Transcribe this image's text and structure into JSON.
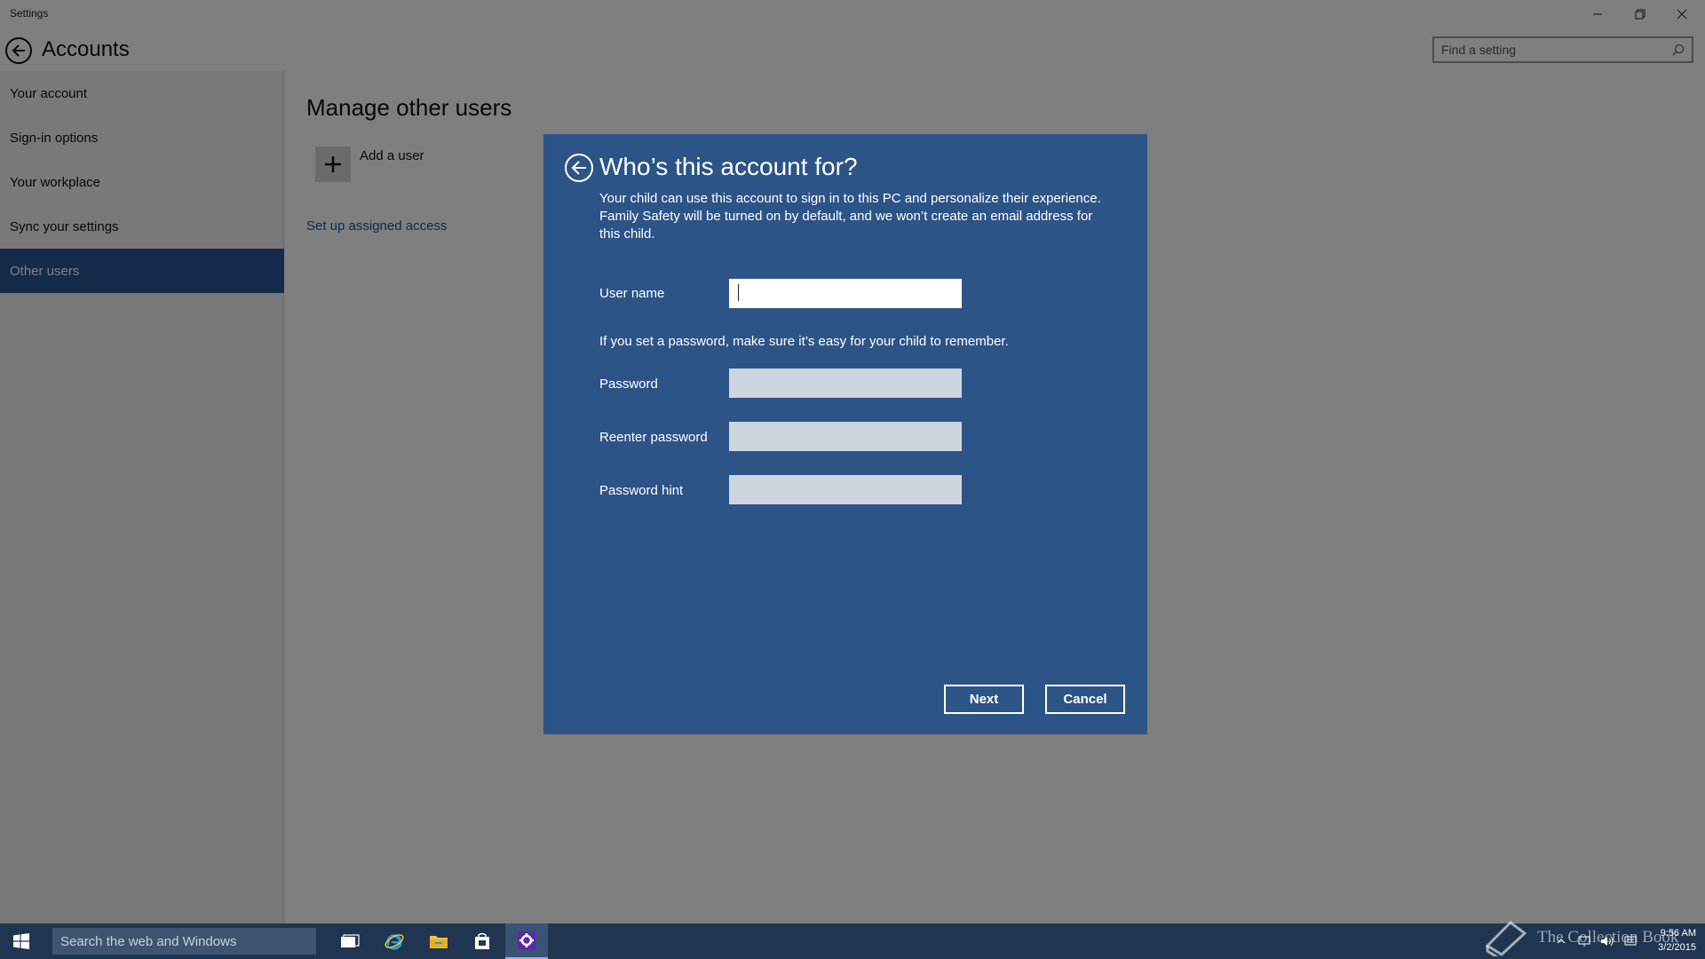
{
  "window": {
    "app_title": "Settings",
    "header_title": "Accounts",
    "search_placeholder": "Find a setting"
  },
  "sidebar": {
    "items": [
      {
        "label": "Your account",
        "selected": false
      },
      {
        "label": "Sign-in options",
        "selected": false
      },
      {
        "label": "Your workplace",
        "selected": false
      },
      {
        "label": "Sync your settings",
        "selected": false
      },
      {
        "label": "Other users",
        "selected": true
      }
    ]
  },
  "content": {
    "section_title": "Manage other users",
    "add_user_label": "Add a user",
    "assigned_access_link": "Set up assigned access"
  },
  "dialog": {
    "title": "Who’s this account for?",
    "description": "Your child can use this account to sign in to this PC and personalize their experience. Family Safety will be turned on by default, and we won’t create an email address for this child.",
    "username_label": "User name",
    "username_value": "",
    "password_note": "If you set a password, make sure it’s easy for your child to remember.",
    "password_label": "Password",
    "reenter_label": "Reenter password",
    "hint_label": "Password hint",
    "next_label": "Next",
    "cancel_label": "Cancel"
  },
  "taskbar": {
    "search_placeholder": "Search the web and Windows",
    "watermark": "The Collection Book",
    "time": "9:56 AM",
    "date": "3/2/2015"
  },
  "colors": {
    "accent": "#2b5797",
    "dialog_bg": "#2d5487",
    "taskbar_bg": "#1f3552"
  }
}
